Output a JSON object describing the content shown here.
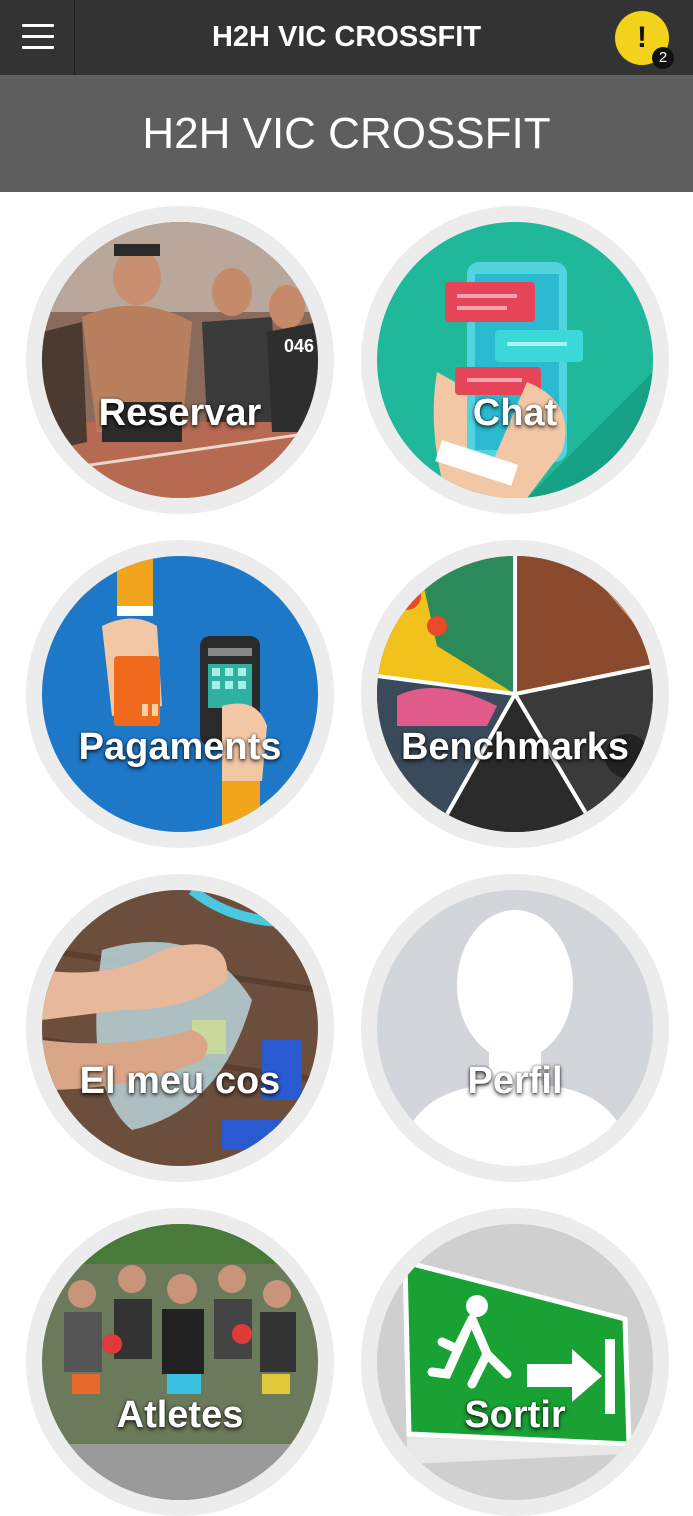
{
  "topbar": {
    "title": "H2H VIC CROSSFIT",
    "alert_mark": "!",
    "notification_count": "2"
  },
  "header": {
    "title": "H2H VIC CROSSFIT"
  },
  "tiles": [
    {
      "label": "Reservar",
      "icon": "athletes-running-photo"
    },
    {
      "label": "Chat",
      "icon": "phone-chat-icon"
    },
    {
      "label": "Pagaments",
      "icon": "card-payment-icon"
    },
    {
      "label": "Benchmarks",
      "icon": "collage-photo"
    },
    {
      "label": "El meu cos",
      "icon": "scale-feet-photo"
    },
    {
      "label": "Perfil",
      "icon": "person-silhouette-icon"
    },
    {
      "label": "Atletes",
      "icon": "crowd-athletes-photo"
    },
    {
      "label": "Sortir",
      "icon": "exit-sign-icon"
    }
  ],
  "colors": {
    "topbar": "#333333",
    "header": "#5e5e5e",
    "alert": "#f2d21b",
    "chat": "#1fb89a",
    "payments": "#1e78c8",
    "exit_sign": "#1aa133"
  }
}
